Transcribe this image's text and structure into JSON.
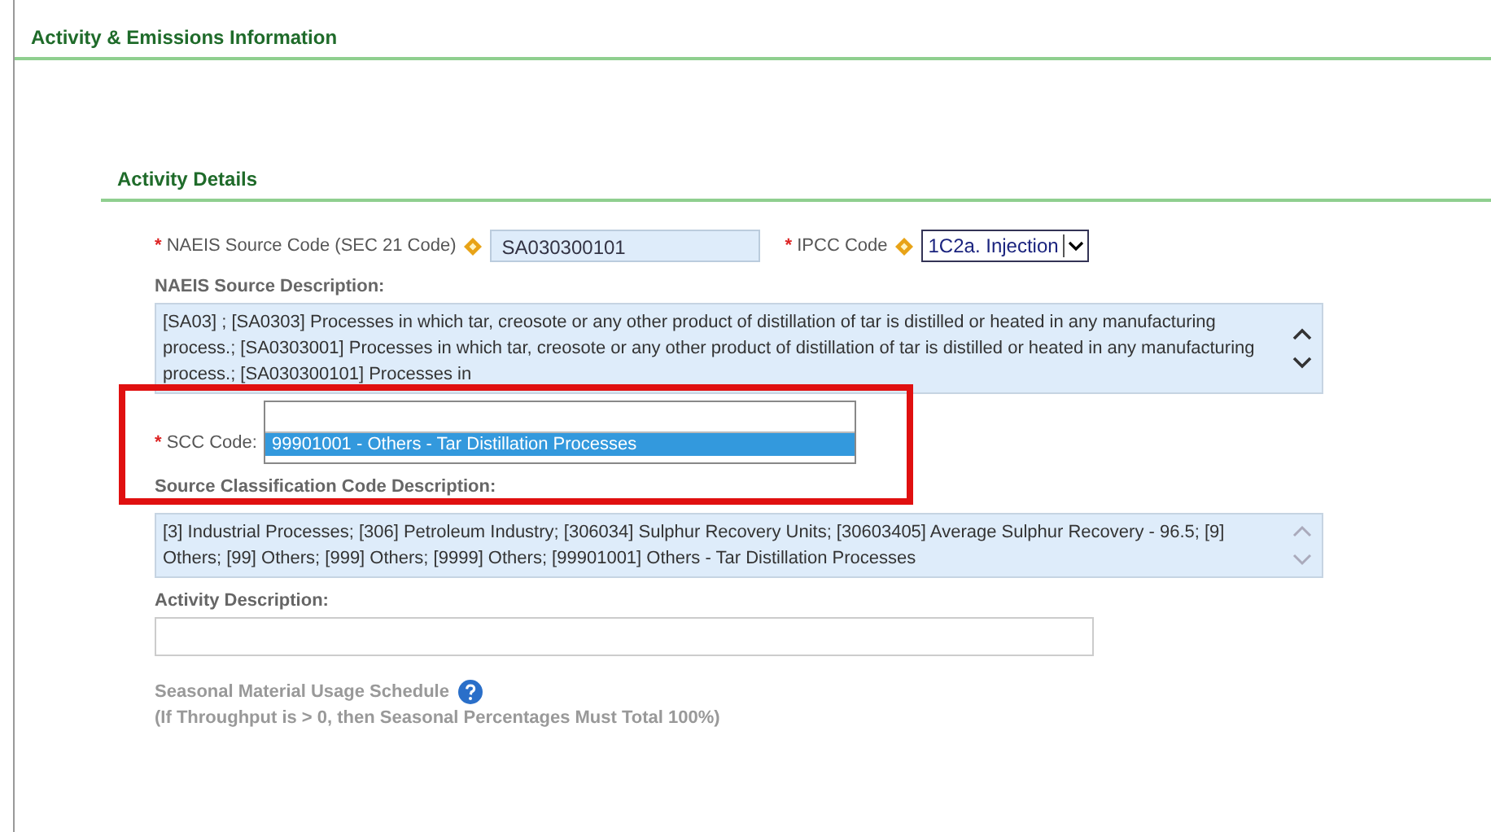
{
  "section": {
    "title": "Activity & Emissions Information"
  },
  "subsection": {
    "title": "Activity Details"
  },
  "naeis_code": {
    "label": "NAEIS Source Code (SEC 21 Code)",
    "required_mark": "*",
    "value": "SA030300101"
  },
  "ipcc_code": {
    "label": "IPCC Code",
    "required_mark": "*",
    "value": "1C2a. Injection"
  },
  "naeis_description": {
    "label": "NAEIS Source Description:",
    "value": "[SA03] ; [SA0303] Processes in which tar, creosote or any other product of distillation of tar is distilled or heated in any manufacturing process.; [SA0303001] Processes in which tar, creosote or any other product of distillation of tar is distilled or heated in any manufacturing process.; [SA030300101] Processes in"
  },
  "scc_code": {
    "label": "SCC Code:",
    "required_mark": "*",
    "options": [
      {
        "label": "99901001 - Others - Tar Distillation Processes",
        "selected": true
      }
    ]
  },
  "scc_description": {
    "label": "Source Classification Code Description:",
    "value": "[3] Industrial Processes; [306] Petroleum Industry; [306034] Sulphur Recovery Units; [30603405] Average Sulphur Recovery - 96.5; [9] Others; [99] Others; [999] Others; [9999] Others; [99901001] Others - Tar Distillation Processes"
  },
  "activity_description": {
    "label": "Activity Description:"
  },
  "seasonal": {
    "title": "Seasonal Material Usage Schedule",
    "note": "(If Throughput is > 0, then Seasonal Percentages Must Total 100%)"
  }
}
